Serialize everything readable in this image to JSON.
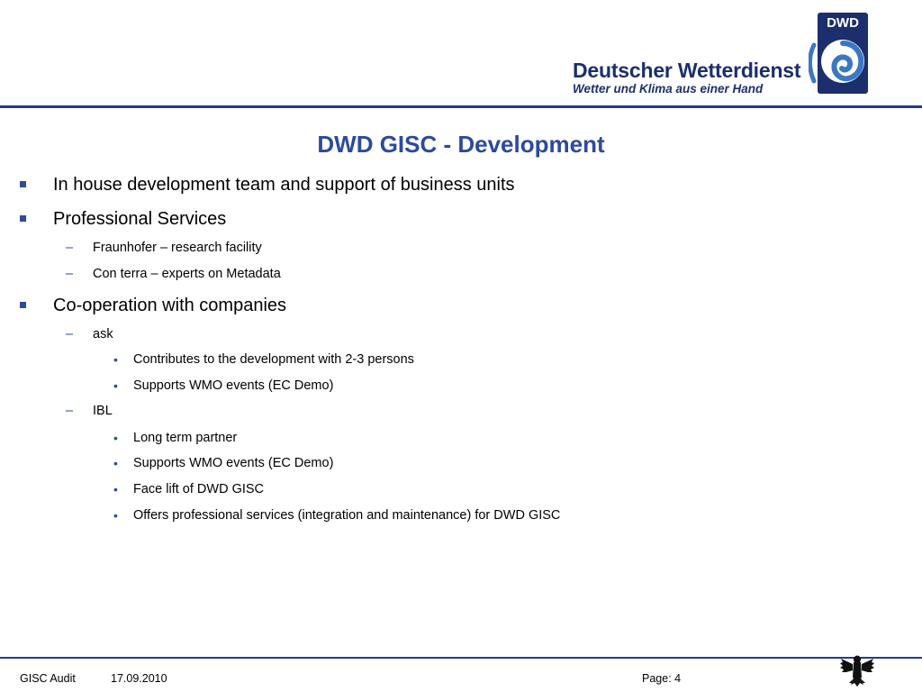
{
  "header": {
    "logo": {
      "badge": "DWD",
      "name": "Deutscher Wetterdienst",
      "slogan": "Wetter und Klima aus einer Hand",
      "icon": "dwd-spiral-logo-icon"
    }
  },
  "slide": {
    "title": "DWD GISC - Development",
    "bullets": [
      {
        "text": "In house development team and support of business units"
      },
      {
        "text": "Professional Services",
        "items": [
          {
            "text": "Fraunhofer – research facility"
          },
          {
            "text": "Con terra – experts on Metadata"
          }
        ]
      },
      {
        "text": "Co-operation with companies",
        "items": [
          {
            "text": "ask",
            "items": [
              "Contributes to the development with 2-3 persons",
              "Supports WMO events (EC Demo)"
            ]
          },
          {
            "text": "IBL",
            "items": [
              "Long term partner",
              "Supports WMO events (EC Demo)",
              "Face lift of DWD GISC",
              "Offers professional services (integration and maintenance) for DWD GISC"
            ]
          }
        ]
      }
    ]
  },
  "markers": {
    "level2": "–",
    "level3": "•"
  },
  "footer": {
    "label": "GISC Audit",
    "date": "17.09.2010",
    "page": "Page: 4",
    "emblem": "federal-eagle-icon"
  },
  "colors": {
    "accent": "#2c4a9e",
    "logo_text": "#1b2f6e",
    "rule": "#1f3d8a"
  }
}
